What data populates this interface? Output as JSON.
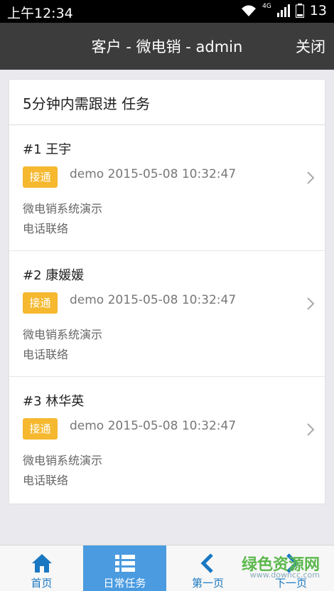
{
  "status": {
    "time": "上午12:34",
    "network": "4G",
    "battery": "13"
  },
  "header": {
    "title": "客户 - 微电销 - admin",
    "close_label": "关闭"
  },
  "card": {
    "title": "5分钟内需跟进 任务"
  },
  "tasks": [
    {
      "name": "#1 王宇",
      "badge": "接通",
      "meta": "demo 2015-05-08 10:32:47",
      "desc": "微电销系统演示",
      "type": "电话联络"
    },
    {
      "name": "#2 康媛媛",
      "badge": "接通",
      "meta": "demo 2015-05-08 10:32:47",
      "desc": "微电销系统演示",
      "type": "电话联络"
    },
    {
      "name": "#3 林华英",
      "badge": "接通",
      "meta": "demo 2015-05-08 10:32:47",
      "desc": "微电销系统演示",
      "type": "电话联络"
    }
  ],
  "tabbar": {
    "tabs": [
      {
        "label": "首页",
        "icon": "home-icon"
      },
      {
        "label": "日常任务",
        "icon": "list-icon",
        "active": true
      },
      {
        "label": "第一页",
        "icon": "chevron-left-icon"
      },
      {
        "label": "下一页",
        "icon": "chevron-right-icon"
      }
    ]
  },
  "watermark": {
    "text": "绿色资源网",
    "url": "www.downcc.com"
  },
  "colors": {
    "accent": "#1a78c2",
    "active_tab": "#4a9be0",
    "badge": "#f5b82e",
    "header": "#3c3c3c"
  }
}
